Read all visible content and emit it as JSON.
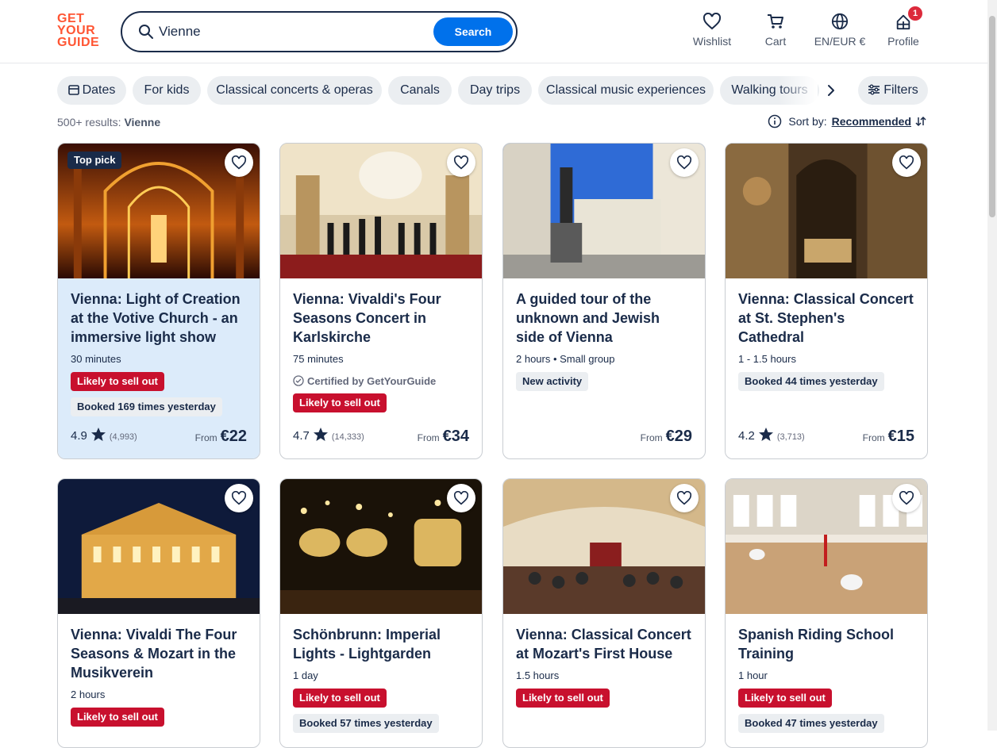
{
  "header": {
    "logo_lines": [
      "GET",
      "YOUR",
      "GUIDE"
    ],
    "search_value": "Vienne",
    "search_button": "Search",
    "nav": {
      "wishlist": "Wishlist",
      "cart": "Cart",
      "language": "EN/EUR €",
      "profile": "Profile",
      "profile_badge": "1"
    }
  },
  "chips": {
    "dates": "Dates",
    "items": [
      "For kids",
      "Classical concerts & operas",
      "Canals",
      "Day trips",
      "Classical music experiences",
      "Walking tours"
    ],
    "filters": "Filters"
  },
  "results": {
    "count": "500+ results:",
    "query": "Vienne"
  },
  "sort": {
    "label": "Sort by:",
    "value": "Recommended"
  },
  "colors": {
    "brand": "#ff5533",
    "accent": "#0071eb",
    "sellout": "#c8102e",
    "navy": "#1a2b49"
  },
  "cards": [
    {
      "toppick": "Top pick",
      "title": "Vienna: Light of Creation at the Votive Church - an immersive light show",
      "meta": "30 minutes",
      "sellout": "Likely to sell out",
      "booked": "Booked 169 times yesterday",
      "rating": "4.9",
      "reviews": "(4,993)",
      "from": "From",
      "price": "€22"
    },
    {
      "title": "Vienna: Vivaldi's Four Seasons Concert in Karlskirche",
      "meta": "75 minutes",
      "certified": "Certified by GetYourGuide",
      "sellout": "Likely to sell out",
      "rating": "4.7",
      "reviews": "(14,333)",
      "from": "From",
      "price": "€34"
    },
    {
      "title": "A guided tour of the unknown and Jewish side of Vienna",
      "meta": "2 hours • Small group",
      "newact": "New activity",
      "from": "From",
      "price": "€29"
    },
    {
      "title": "Vienna: Classical Concert at St. Stephen's Cathedral",
      "meta": "1 - 1.5 hours",
      "booked": "Booked 44 times yesterday",
      "rating": "4.2",
      "reviews": "(3,713)",
      "from": "From",
      "price": "€15"
    },
    {
      "title": "Vienna: Vivaldi The Four Seasons & Mozart in the Musikverein",
      "meta": "2 hours",
      "sellout": "Likely to sell out"
    },
    {
      "title": "Schönbrunn: Imperial Lights - Lightgarden",
      "meta": "1 day",
      "sellout": "Likely to sell out",
      "booked": "Booked 57 times yesterday"
    },
    {
      "title": "Vienna: Classical Concert at Mozart's First House",
      "meta": "1.5 hours",
      "sellout": "Likely to sell out"
    },
    {
      "title": "Spanish Riding School Training",
      "meta": "1 hour",
      "sellout": "Likely to sell out",
      "booked": "Booked 47 times yesterday"
    }
  ]
}
